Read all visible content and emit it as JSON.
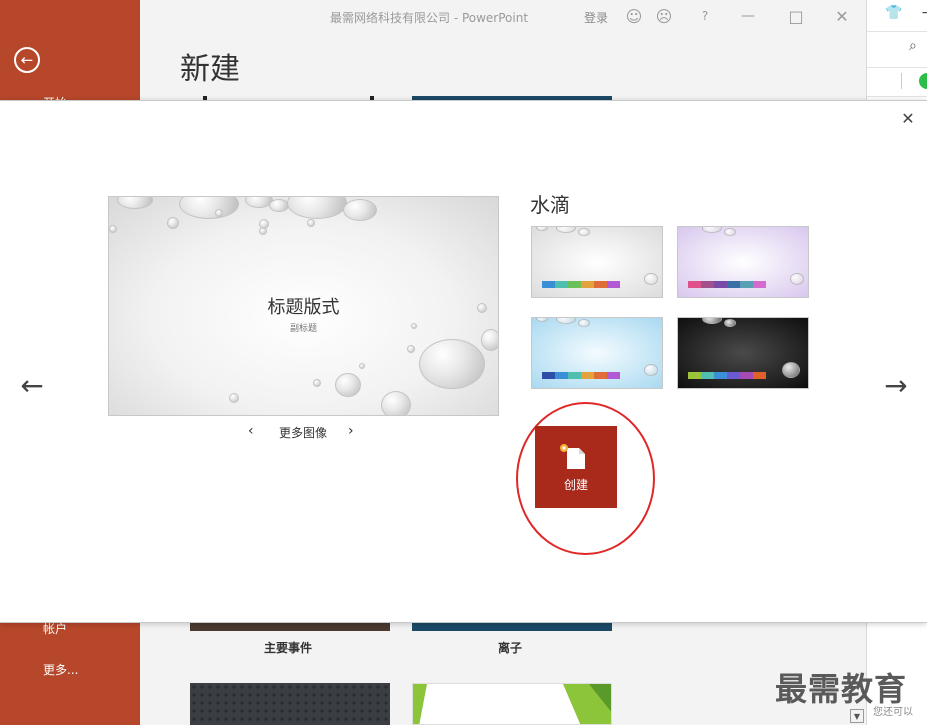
{
  "window": {
    "title": "最需网络科技有限公司  -  PowerPoint",
    "login": "登录",
    "help": "?"
  },
  "sidebar": {
    "items": [
      {
        "label": "开始"
      },
      {
        "label": "帐户"
      },
      {
        "label": "更多..."
      }
    ]
  },
  "backstage": {
    "title": "新建",
    "templates": [
      {
        "label": "主要事件"
      },
      {
        "label": "离子"
      }
    ]
  },
  "modal": {
    "preview": {
      "title": "标题版式",
      "subtitle": "副标题"
    },
    "more_images_label": "更多图像",
    "theme_name": "水滴",
    "variants": [
      {
        "bg": "light",
        "swatches": [
          "#3a8fd6",
          "#4fbfb0",
          "#6cc05a",
          "#e3a23a",
          "#e06c3a",
          "#b25ad6"
        ]
      },
      {
        "bg": "lavender",
        "swatches": [
          "#e0508a",
          "#a2508c",
          "#7a4aa8",
          "#3b6fa8",
          "#5aa0b4",
          "#d46ad0"
        ]
      },
      {
        "bg": "blue",
        "swatches": [
          "#2d4ea8",
          "#3c8fd6",
          "#4fbfb0",
          "#e3a23a",
          "#e06c3a",
          "#b25ad6"
        ]
      },
      {
        "bg": "dark",
        "swatches": [
          "#9bc43a",
          "#4fbfb0",
          "#3c8fd6",
          "#6a5ad6",
          "#a64ab4",
          "#e0602a"
        ]
      }
    ],
    "create_label": "创建"
  },
  "watermark": {
    "text": "最需教育",
    "sub": "您还可以"
  }
}
